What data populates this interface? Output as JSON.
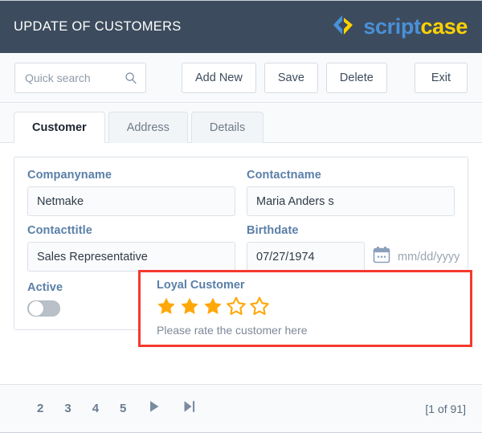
{
  "header": {
    "title": "UPDATE OF CUSTOMERS",
    "logo": {
      "mark_icon": "scriptcase-chevron-icon",
      "text_primary": "script",
      "text_accent": "case",
      "primary_color": "#4a90d9",
      "accent_color": "#ffd200",
      "background_color": "#3c4c5e"
    }
  },
  "toolbar": {
    "search": {
      "placeholder": "Quick search",
      "value": "",
      "icon": "magnifier-icon"
    },
    "buttons": [
      {
        "label": "Add New",
        "name": "add-new-button"
      },
      {
        "label": "Save",
        "name": "save-button"
      },
      {
        "label": "Delete",
        "name": "delete-button"
      }
    ],
    "exit_label": "Exit"
  },
  "tabs": [
    {
      "label": "Customer",
      "active": true
    },
    {
      "label": "Address",
      "active": false
    },
    {
      "label": "Details",
      "active": false
    }
  ],
  "form": {
    "companyname": {
      "label": "Companyname",
      "value": "Netmake"
    },
    "contactname": {
      "label": "Contactname",
      "value": "Maria Anders s"
    },
    "contacttitle": {
      "label": "Contacttitle",
      "value": "Sales Representative"
    },
    "birthdate": {
      "label": "Birthdate",
      "value": "07/27/1974",
      "hint": "mm/dd/yyyy",
      "icon": "calendar-icon"
    },
    "active": {
      "label": "Active",
      "checked": false
    },
    "loyal_customer": {
      "label": "Loyal Customer",
      "rating": 3,
      "max_rating": 5,
      "hint": "Please rate the customer here",
      "star_color": "#ffa80a"
    },
    "highlight_color": "#f43a2f"
  },
  "footer": {
    "pages": [
      "2",
      "3",
      "4",
      "5"
    ],
    "next_icon": "next-page-icon",
    "last_icon": "last-page-icon",
    "counter": "[1 of 91]"
  }
}
